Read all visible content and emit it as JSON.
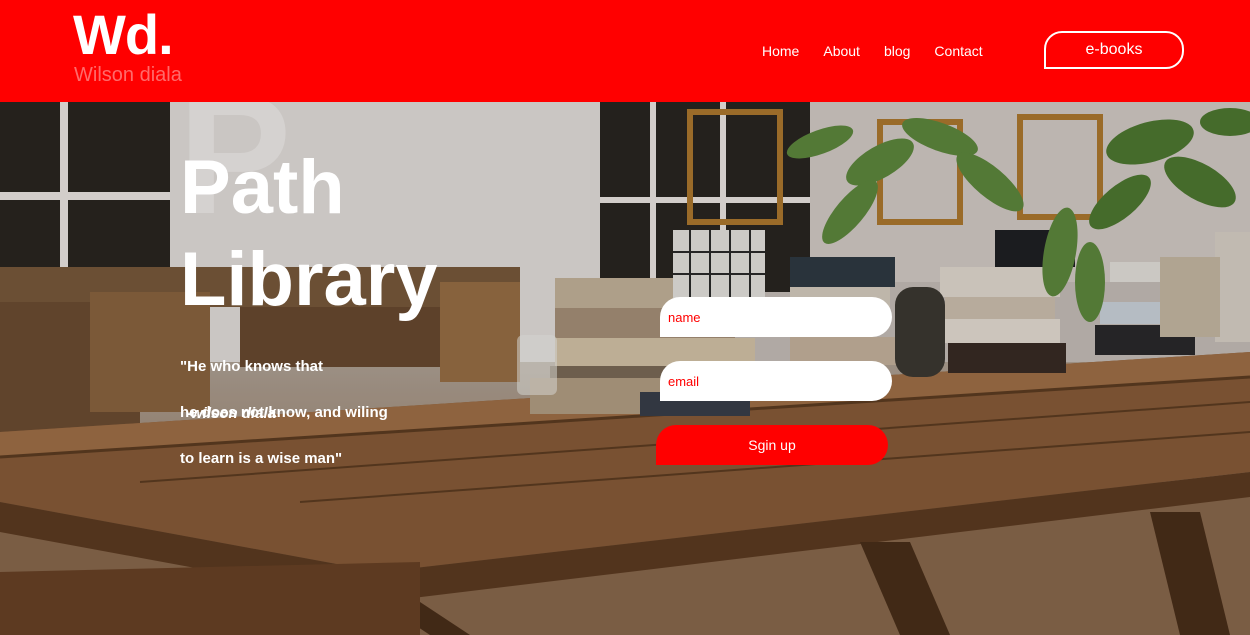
{
  "brand": {
    "logo_mark": "Wd.",
    "logo_subtitle": "Wilson diala"
  },
  "nav": {
    "items": [
      {
        "label": "Home"
      },
      {
        "label": "About"
      },
      {
        "label": "blog"
      },
      {
        "label": "Contact"
      }
    ],
    "cta_label": "e-books"
  },
  "hero": {
    "watermark_letter": "P",
    "title_line1": "Path",
    "title_line2": "Library",
    "quote_line1": "\"He who knows that",
    "quote_line2": "he does not know, and wiling",
    "quote_line3": "to learn is a wise man\"",
    "quote_author": "-wilson diala"
  },
  "signup": {
    "name_placeholder": "name",
    "email_placeholder": "email",
    "submit_label": "Sgin up"
  },
  "colors": {
    "accent": "#ff0000",
    "logo_sub": "#ff6a6a",
    "text_light": "#ffffff"
  }
}
